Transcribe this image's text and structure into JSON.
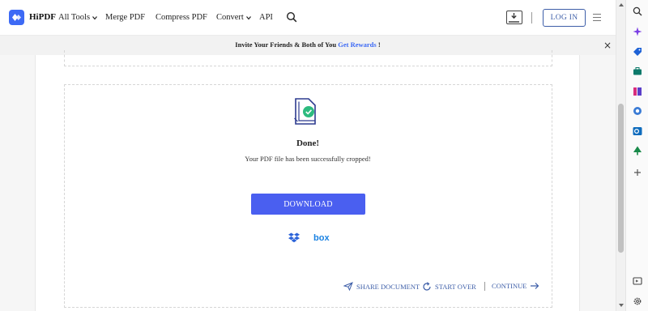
{
  "nav": {
    "brand": "HiPDF",
    "items": [
      {
        "label": "All Tools",
        "has_caret": true
      },
      {
        "label": "Merge PDF",
        "has_caret": false
      },
      {
        "label": "Compress PDF",
        "has_caret": false
      },
      {
        "label": "Convert",
        "has_caret": true
      },
      {
        "label": "API",
        "has_caret": false
      }
    ],
    "login_label": "LOG IN"
  },
  "banner": {
    "text": "Invite Your Friends & Both of You",
    "link": "Get Rewards",
    "suffix": " !",
    "close": "×"
  },
  "result": {
    "title": "Done!",
    "message": "Your PDF file has been successfully cropped!",
    "download_label": "DOWNLOAD",
    "cloud_box_label": "box"
  },
  "actions": {
    "share": "SHARE DOCUMENT",
    "start_over": "START OVER",
    "continue": "CONTINUE"
  },
  "colors": {
    "accent": "#4a5ff0",
    "link": "#3d5ea8",
    "success": "#2dbb7f"
  },
  "icons": [
    "logo-icon",
    "search-icon",
    "download-tray-icon",
    "menu-icon",
    "document-check-icon",
    "dropbox-icon",
    "send-icon",
    "refresh-icon",
    "arrow-right-icon"
  ],
  "extensions": [
    "sparkle-icon",
    "tag-icon",
    "briefcase-icon",
    "game-icon",
    "puzzle-icon",
    "outlook-icon",
    "tree-icon",
    "add-icon",
    "sidebar-toggle-icon",
    "settings-icon"
  ]
}
